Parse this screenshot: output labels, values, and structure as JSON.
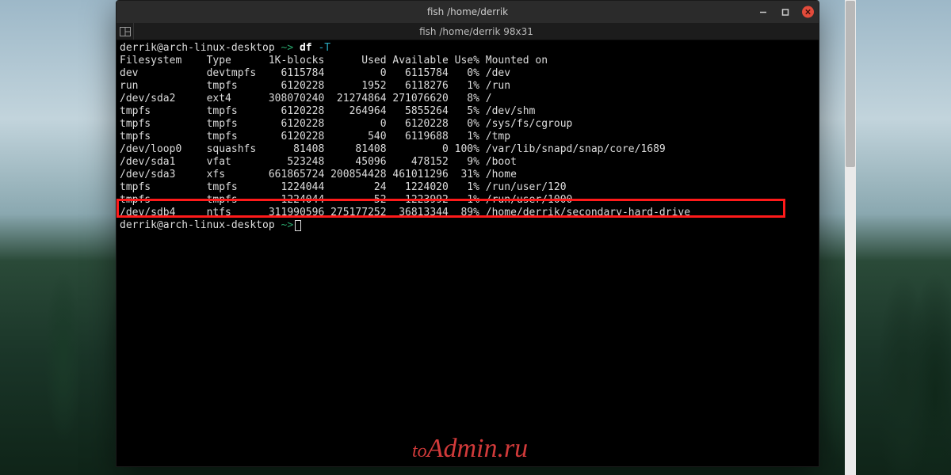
{
  "titlebar": {
    "title": "fish  /home/derrik"
  },
  "tabbar": {
    "label": "fish  /home/derrik 98x31"
  },
  "prompt": {
    "user_host": "derrik@arch-linux-desktop",
    "path": "~",
    "sep": ">",
    "command": "df",
    "flag": "-T"
  },
  "columns": {
    "filesystem": "Filesystem",
    "type": "Type",
    "blocks": "1K-blocks",
    "used": "Used",
    "available": "Available",
    "usep": "Use%",
    "mounted": "Mounted on"
  },
  "rows": [
    {
      "fs": "dev",
      "type": "devtmpfs",
      "blocks": "6115784",
      "used": "0",
      "avail": "6115784",
      "usep": "0%",
      "mnt": "/dev"
    },
    {
      "fs": "run",
      "type": "tmpfs",
      "blocks": "6120228",
      "used": "1952",
      "avail": "6118276",
      "usep": "1%",
      "mnt": "/run"
    },
    {
      "fs": "/dev/sda2",
      "type": "ext4",
      "blocks": "308070240",
      "used": "21274864",
      "avail": "271076620",
      "usep": "8%",
      "mnt": "/"
    },
    {
      "fs": "tmpfs",
      "type": "tmpfs",
      "blocks": "6120228",
      "used": "264964",
      "avail": "5855264",
      "usep": "5%",
      "mnt": "/dev/shm"
    },
    {
      "fs": "tmpfs",
      "type": "tmpfs",
      "blocks": "6120228",
      "used": "0",
      "avail": "6120228",
      "usep": "0%",
      "mnt": "/sys/fs/cgroup"
    },
    {
      "fs": "tmpfs",
      "type": "tmpfs",
      "blocks": "6120228",
      "used": "540",
      "avail": "6119688",
      "usep": "1%",
      "mnt": "/tmp"
    },
    {
      "fs": "/dev/loop0",
      "type": "squashfs",
      "blocks": "81408",
      "used": "81408",
      "avail": "0",
      "usep": "100%",
      "mnt": "/var/lib/snapd/snap/core/1689"
    },
    {
      "fs": "/dev/sda1",
      "type": "vfat",
      "blocks": "523248",
      "used": "45096",
      "avail": "478152",
      "usep": "9%",
      "mnt": "/boot"
    },
    {
      "fs": "/dev/sda3",
      "type": "xfs",
      "blocks": "661865724",
      "used": "200854428",
      "avail": "461011296",
      "usep": "31%",
      "mnt": "/home"
    },
    {
      "fs": "tmpfs",
      "type": "tmpfs",
      "blocks": "1224044",
      "used": "24",
      "avail": "1224020",
      "usep": "1%",
      "mnt": "/run/user/120"
    },
    {
      "fs": "tmpfs",
      "type": "tmpfs",
      "blocks": "1224044",
      "used": "52",
      "avail": "1223992",
      "usep": "1%",
      "mnt": "/run/user/1000"
    },
    {
      "fs": "/dev/sdb4",
      "type": "ntfs",
      "blocks": "311990596",
      "used": "275177252",
      "avail": "36813344",
      "usep": "89%",
      "mnt": "/home/derrik/secondary-hard-drive"
    }
  ],
  "highlight_row_index": 11,
  "watermark": "toAdmin.ru"
}
